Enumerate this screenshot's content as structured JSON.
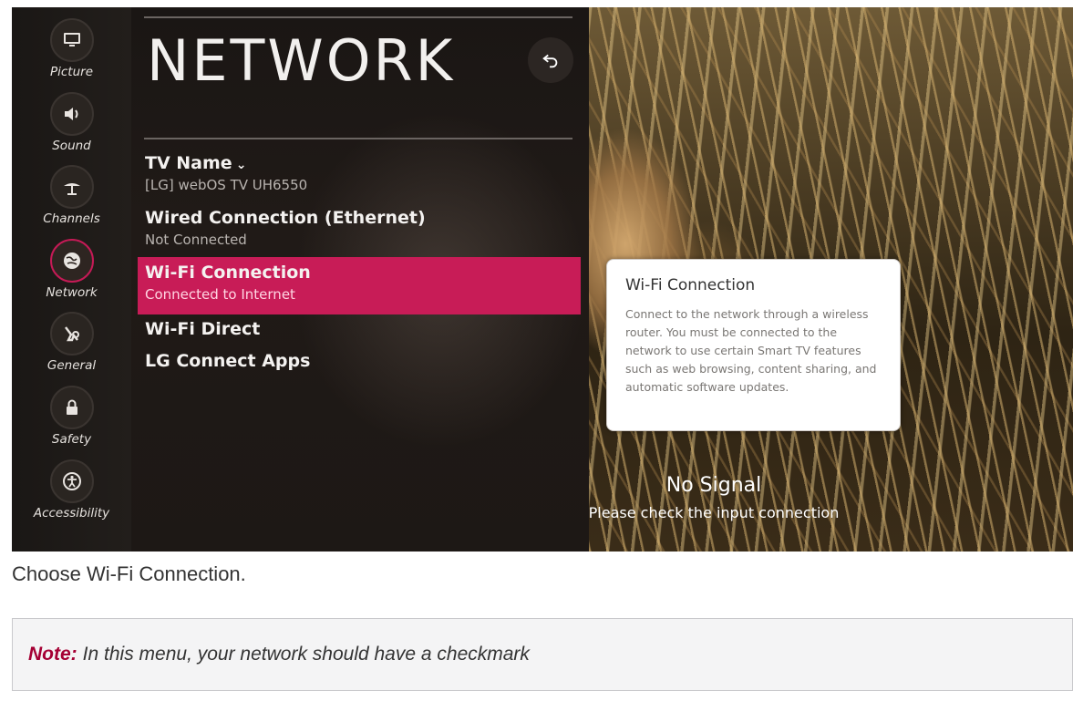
{
  "tv": {
    "sidebar": [
      {
        "label": "Picture",
        "icon": "monitor-icon"
      },
      {
        "label": "Sound",
        "icon": "speaker-icon"
      },
      {
        "label": "Channels",
        "icon": "antenna-icon"
      },
      {
        "label": "Network",
        "icon": "globe-icon",
        "active": true
      },
      {
        "label": "General",
        "icon": "general-icon"
      },
      {
        "label": "Safety",
        "icon": "lock-icon"
      },
      {
        "label": "Accessibility",
        "icon": "accessibility-icon"
      }
    ],
    "title": "NETWORK",
    "menu": [
      {
        "title": "TV Name",
        "sub": "[LG] webOS TV UH6550",
        "chevron": "⌄"
      },
      {
        "title": "Wired Connection (Ethernet)",
        "sub": "Not Connected"
      },
      {
        "title": "Wi-Fi Connection",
        "sub": "Connected to Internet",
        "selected": true
      },
      {
        "title": "Wi-Fi Direct",
        "sub": ""
      },
      {
        "title": "LG Connect Apps",
        "sub": ""
      }
    ],
    "tooltip": {
      "title": "Wi-Fi Connection",
      "body": "Connect to the network through a wireless router. You must be connected to the network to use certain Smart TV features such as web browsing, content sharing, and automatic software updates."
    },
    "no_signal": {
      "title": "No Signal",
      "sub": "Please check the input connection"
    },
    "accent": "#c81c57"
  },
  "article": {
    "caption": "Choose Wi-Fi Connection.",
    "note_label": "Note:",
    "note_text": "In this menu, your network should have a checkmark",
    "note_color": "#a50034"
  }
}
